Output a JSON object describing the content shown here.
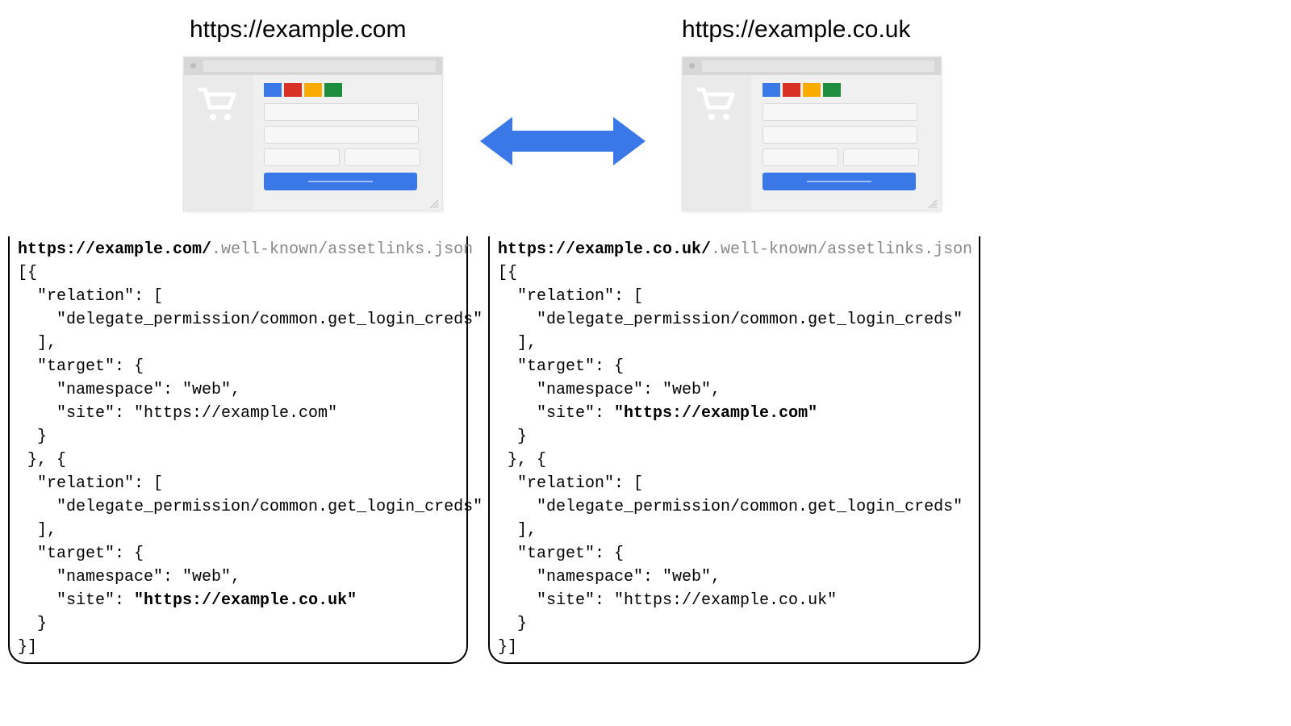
{
  "left": {
    "title": "https://example.com",
    "url_prefix": "https://example.com/",
    "url_suffix": ".well-known/assetlinks.json",
    "code_pre_a": "[{\n  \"relation\": [\n    \"delegate_permission/common.get_login_creds\"\n  ],\n  \"target\": {\n    \"namespace\": \"web\",\n    \"site\": \"https://example.com\"\n  }\n }, {\n  \"relation\": [\n    \"delegate_permission/common.get_login_creds\"\n  ],\n  \"target\": {\n    \"namespace\": \"web\",\n    \"site\": ",
    "bold_site": "\"https://example.co.uk\"",
    "code_pre_b": "\n  }\n}]"
  },
  "right": {
    "title": "https://example.co.uk",
    "url_prefix": "https://example.co.uk/",
    "url_suffix": ".well-known/assetlinks.json",
    "code_pre_a": "[{\n  \"relation\": [\n    \"delegate_permission/common.get_login_creds\"\n  ],\n  \"target\": {\n    \"namespace\": \"web\",\n    \"site\": ",
    "bold_site": "\"https://example.com\"",
    "code_pre_b": "\n  }\n }, {\n  \"relation\": [\n    \"delegate_permission/common.get_login_creds\"\n  ],\n  \"target\": {\n    \"namespace\": \"web\",\n    \"site\": \"https://example.co.uk\"\n  }\n}]"
  },
  "colors": {
    "logo": [
      "#3b78e7",
      "#d93025",
      "#f9ab00",
      "#1e8e3e"
    ],
    "arrow": "#3b78e7"
  }
}
